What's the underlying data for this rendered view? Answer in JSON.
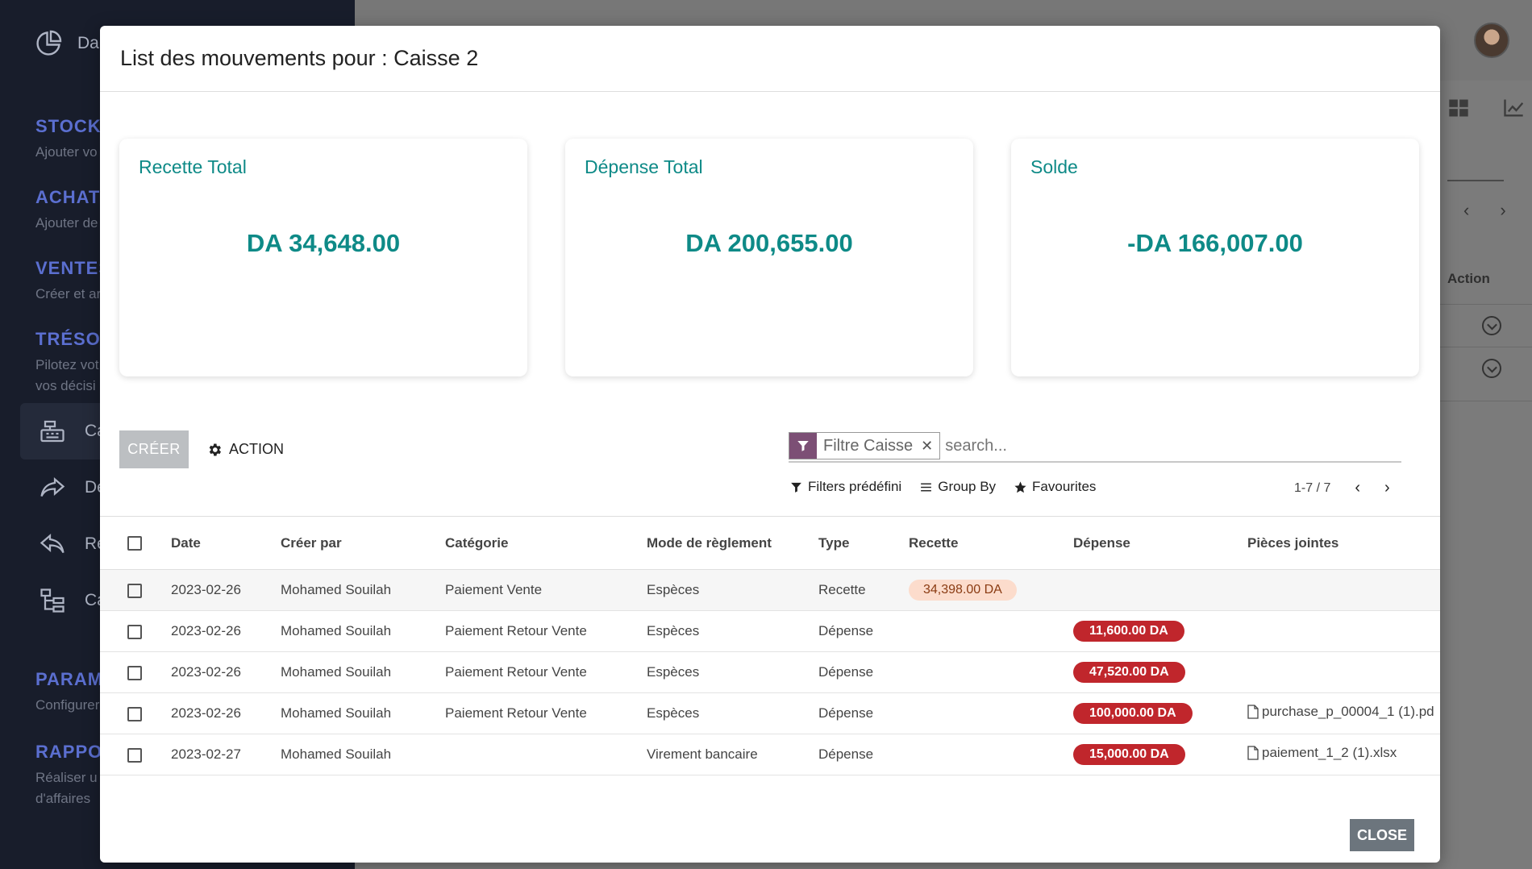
{
  "sidebar": {
    "top_label": "Da",
    "sections": [
      {
        "title": "STOCK",
        "sub": "Ajouter vo"
      },
      {
        "title": "ACHATS",
        "sub": "Ajouter de"
      },
      {
        "title": "VENTES",
        "sub": "Créer et ar"
      },
      {
        "title": "TRÉSOR",
        "sub": "Pilotez vot",
        "sub2": "vos décisi"
      },
      {
        "title": "PARAM",
        "sub": "Configurer"
      },
      {
        "title": "RAPPO",
        "sub": "Réaliser u",
        "sub2": "d'affaires"
      }
    ],
    "items": [
      {
        "label": "Ca"
      },
      {
        "label": "Dé"
      },
      {
        "label": "Re"
      },
      {
        "label": "Ca"
      }
    ]
  },
  "background": {
    "action_header": "Action"
  },
  "dialog": {
    "title": "List des mouvements pour : Caisse 2",
    "cards": [
      {
        "title": "Recette Total",
        "value": "DA 34,648.00"
      },
      {
        "title": "Dépense Total",
        "value": "DA 200,655.00"
      },
      {
        "title": "Solde",
        "value": "-DA 166,007.00"
      }
    ],
    "create_label": "CRÉER",
    "action_label": "ACTION",
    "search": {
      "facet_label": "Filtre Caisse",
      "placeholder": "search..."
    },
    "filters": {
      "predefined": "Filters prédéfini",
      "group_by": "Group By",
      "favourites": "Favourites"
    },
    "pager": "1-7 / 7",
    "columns": [
      "Date",
      "Créer par",
      "Catégorie",
      "Mode de règlement",
      "Type",
      "Recette",
      "Dépense",
      "Pièces jointes"
    ],
    "rows": [
      {
        "date": "2023-02-26",
        "by": "Mohamed Souilah",
        "cat": "Paiement Vente",
        "mode": "Espèces",
        "type": "Recette",
        "recette": "34,398.00 DA",
        "depense": "",
        "file": ""
      },
      {
        "date": "2023-02-26",
        "by": "Mohamed Souilah",
        "cat": "Paiement Retour Vente",
        "mode": "Espèces",
        "type": "Dépense",
        "recette": "",
        "depense": "11,600.00 DA",
        "file": ""
      },
      {
        "date": "2023-02-26",
        "by": "Mohamed Souilah",
        "cat": "Paiement Retour Vente",
        "mode": "Espèces",
        "type": "Dépense",
        "recette": "",
        "depense": "47,520.00 DA",
        "file": ""
      },
      {
        "date": "2023-02-26",
        "by": "Mohamed Souilah",
        "cat": "Paiement Retour Vente",
        "mode": "Espèces",
        "type": "Dépense",
        "recette": "",
        "depense": "100,000.00 DA",
        "file": "purchase_p_00004_1 (1).pd"
      },
      {
        "date": "2023-02-27",
        "by": "Mohamed Souilah",
        "cat": "",
        "mode": "Virement bancaire",
        "type": "Dépense",
        "recette": "",
        "depense": "15,000.00 DA",
        "file": "paiement_1_2 (1).xlsx"
      }
    ],
    "close_label": "CLOSE"
  },
  "colors": {
    "accent": "#0e8a87",
    "danger": "#c0262c",
    "facet": "#7c4f75"
  }
}
